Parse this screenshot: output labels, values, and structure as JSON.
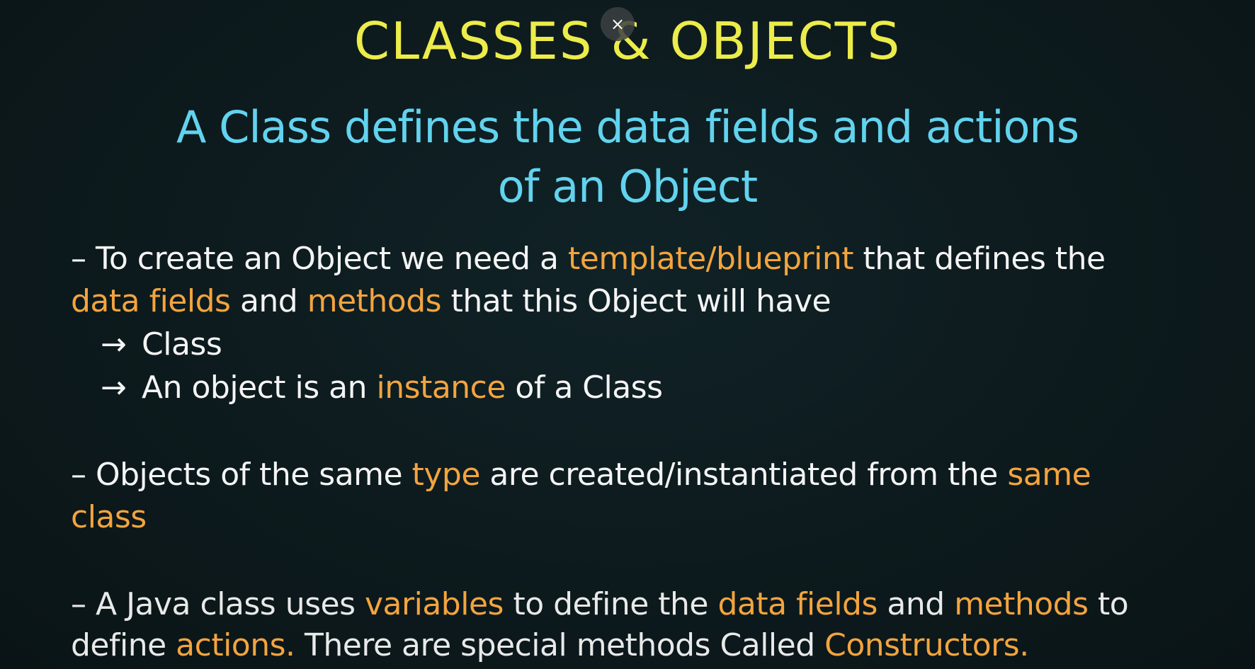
{
  "overlay": {
    "close_icon": "×"
  },
  "slide": {
    "title_part1": "CLASSES",
    "title_amp": "&",
    "title_part2": "OBJECTS",
    "subtitle_line1": "A Class defines the data fields and actions",
    "subtitle_line2": "of an Object",
    "point1": {
      "line1": {
        "a": "– To create an Object we need a ",
        "b": "template/blueprint",
        "c": " that defines the"
      },
      "line2": {
        "a": "data fields",
        "b": " and ",
        "c": "methods",
        "d": " that this Object will have"
      },
      "sub1": {
        "arrow": "→",
        "text": "Class"
      },
      "sub2": {
        "arrow": "→",
        "a": "An object is an ",
        "b": "instance",
        "c": " of a Class"
      }
    },
    "point2": {
      "line1": {
        "a": "– Objects of the same ",
        "b": "type",
        "c": " are created/instantiated from the ",
        "d": "same"
      },
      "line2": {
        "a": "class"
      }
    },
    "point3": {
      "line1": {
        "a": "– A Java class uses ",
        "b": "variables",
        "c": " to define the ",
        "d": "data fields",
        "e": " and ",
        "f": "methods",
        "g": " to"
      },
      "line2": {
        "a": "define ",
        "b": "actions.",
        "c": " There are special methods Called ",
        "d": "Constructors."
      }
    }
  },
  "colors": {
    "title": "#ecec4a",
    "subtitle": "#62d3ee",
    "highlight": "#f3a43f",
    "body_text": "#f4f4f4",
    "background": "#0d1a1d"
  }
}
